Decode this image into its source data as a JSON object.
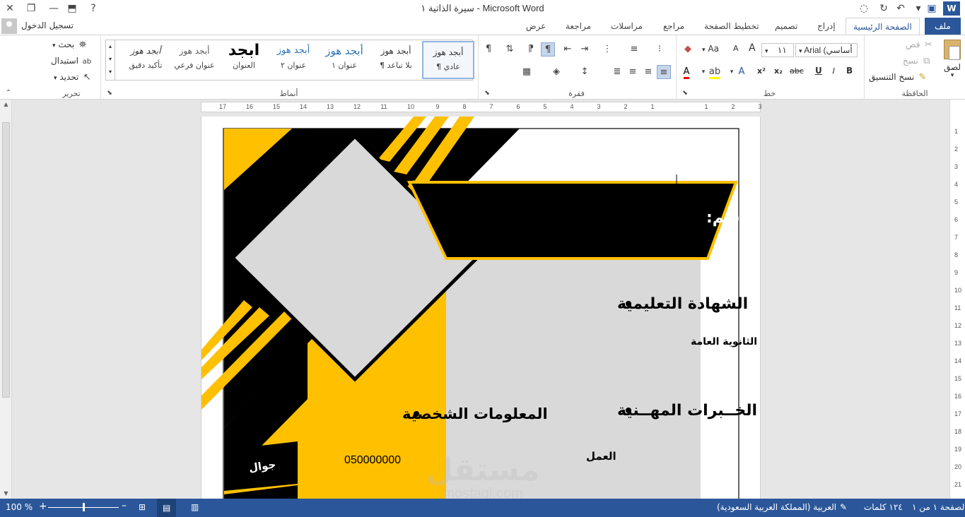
{
  "titlebar": {
    "title": "سيرة الذاتية ١ - Microsoft Word",
    "help_icon": "?",
    "buttons": [
      "close",
      "restore",
      "ribbon-display",
      "help"
    ],
    "qat": [
      "word-logo",
      "save",
      "undo",
      "redo",
      "touch-mode"
    ]
  },
  "tabs": {
    "file": "ملف",
    "home": "الصفحة الرئيسية",
    "insert": "إدراج",
    "design": "تصميم",
    "layout": "تخطيط الصفحة",
    "references": "مراجع",
    "mailings": "مراسلات",
    "review": "مراجعة",
    "view": "عرض",
    "signin": "تسجيل الدخول"
  },
  "ribbon": {
    "clipboard": {
      "label": "الحافظة",
      "paste": "لصق",
      "cut": "قص",
      "copy": "نسخ",
      "format_painter": "نسخ التنسيق"
    },
    "font": {
      "label": "خط",
      "font_name": "Arial (أساسي",
      "font_size": "١١",
      "bold": "B",
      "italic": "I",
      "underline": "U",
      "strike": "abc",
      "sub": "x₂",
      "sup": "x²",
      "grow": "A",
      "shrink": "A",
      "case": "Aa"
    },
    "paragraph": {
      "label": "فقرة"
    },
    "styles": {
      "label": "أنماط",
      "items": [
        {
          "sample": "أبجد هوز",
          "name": "¶ عادي"
        },
        {
          "sample": "أبجد هوز",
          "name": "¶ بلا تباعد"
        },
        {
          "sample": "أبجد هوز",
          "name": "عنوان ١"
        },
        {
          "sample": "أبجد هوز",
          "name": "عنوان ٢"
        },
        {
          "sample": "ابجد",
          "name": "العنوان"
        },
        {
          "sample": "أبجد هوز",
          "name": "عنوان فرعي"
        },
        {
          "sample": "أبجد هوز",
          "name": "تأكيد دقيق"
        }
      ]
    },
    "editing": {
      "label": "تحرير",
      "find": "بحث",
      "replace": "استبدال",
      "select": "تحديد"
    }
  },
  "ruler": {
    "numbers": [
      "17",
      "16",
      "15",
      "14",
      "13",
      "12",
      "11",
      "10",
      "9",
      "8",
      "7",
      "6",
      "5",
      "4",
      "3",
      "2",
      "1",
      "",
      "1",
      "2",
      "3"
    ]
  },
  "vruler": {
    "numbers": [
      "1",
      "2",
      "3",
      "4",
      "5",
      "6",
      "7",
      "8",
      "9",
      "10",
      "11",
      "12",
      "13",
      "14",
      "15",
      "16",
      "17",
      "18",
      "19",
      "20",
      "21"
    ]
  },
  "document": {
    "name_label": "الاسم:",
    "education_heading": "الشهادة التعليمية",
    "education_value": "الثانوية العامة",
    "experience_heading": "الخــبرات المهــنية",
    "experience_value": "العمل",
    "personal_heading": "المعلومات الشخصية",
    "mobile_label": "جوال",
    "mobile_value": "050000000",
    "colors": {
      "yellow": "#FFC000",
      "black": "#000000",
      "gray": "#D9D9D9"
    }
  },
  "statusbar": {
    "page": "الصفحة ١ من ١",
    "words": "١٢٤ كلمات",
    "language": "العربية (المملكة العربية السعودية)",
    "zoom": "100 %",
    "zoom_level": 0.5
  },
  "watermark": {
    "arabic": "مستقل",
    "latin": "mostaql.com"
  }
}
